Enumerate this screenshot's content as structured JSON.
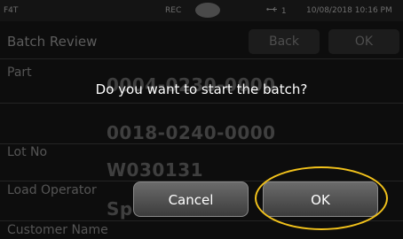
{
  "status_bar": {
    "left_text": "F4T",
    "rec_text": "REC",
    "usb_text": "1",
    "datetime": "10/08/2018 10:16 PM"
  },
  "header": {
    "title": "Batch Review",
    "back_label": "Back",
    "ok_label": "OK"
  },
  "fields": {
    "part_label": "Part",
    "part_value": "0004-0230-0000",
    "second_value": "0018-0240-0000",
    "lot_label": "Lot No",
    "lot_value": "W030131",
    "operator_label": "Load Operator",
    "operator_value": "Sp",
    "customer_label": "Customer Name"
  },
  "dialog": {
    "message": "Do you want to start the batch?",
    "cancel_label": "Cancel",
    "ok_label": "OK"
  },
  "colors": {
    "highlight": "#f2c21b"
  }
}
